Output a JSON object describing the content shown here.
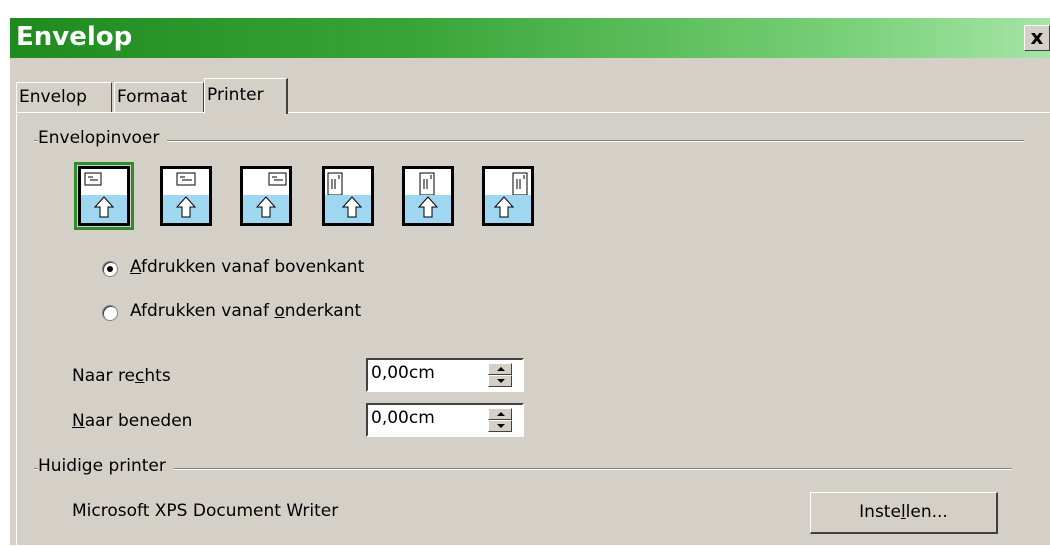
{
  "window": {
    "title": "Envelop",
    "close_label": "x"
  },
  "tabs": [
    {
      "label": "Envelop",
      "active": false
    },
    {
      "label": "Formaat",
      "active": false
    },
    {
      "label": "Printer",
      "active": true
    }
  ],
  "envelope_feed": {
    "group_label": "Envelopinvoer",
    "icons": [
      {
        "name": "feed-horizontal-left-icon",
        "selected": true
      },
      {
        "name": "feed-horizontal-center-icon",
        "selected": false
      },
      {
        "name": "feed-horizontal-right-icon",
        "selected": false
      },
      {
        "name": "feed-vertical-left-icon",
        "selected": false
      },
      {
        "name": "feed-vertical-center-icon",
        "selected": false
      },
      {
        "name": "feed-vertical-right-icon",
        "selected": false
      }
    ],
    "radio_top": {
      "pre": "",
      "mnemonic": "A",
      "post": "fdrukken vanaf bovenkant",
      "checked": true
    },
    "radio_bottom": {
      "pre": "Afdrukken vanaf ",
      "mnemonic": "o",
      "post": "nderkant",
      "checked": false
    },
    "shift_right": {
      "pre": "Naar re",
      "mnemonic": "c",
      "post": "hts",
      "value": "0,00cm"
    },
    "shift_down": {
      "pre": "",
      "mnemonic": "N",
      "post": "aar beneden",
      "value": "0,00cm"
    }
  },
  "current_printer": {
    "group_label": "Huidige printer",
    "name": "Microsoft XPS Document Writer",
    "setup_pre": "Inste",
    "setup_mnemonic": "l",
    "setup_post": "len..."
  },
  "colors": {
    "title_green": "#1f8a1f",
    "dialog_bg": "#d4d0c8",
    "selection_green": "#2e8b2e",
    "arrow_blue": "#2aa0d8"
  }
}
